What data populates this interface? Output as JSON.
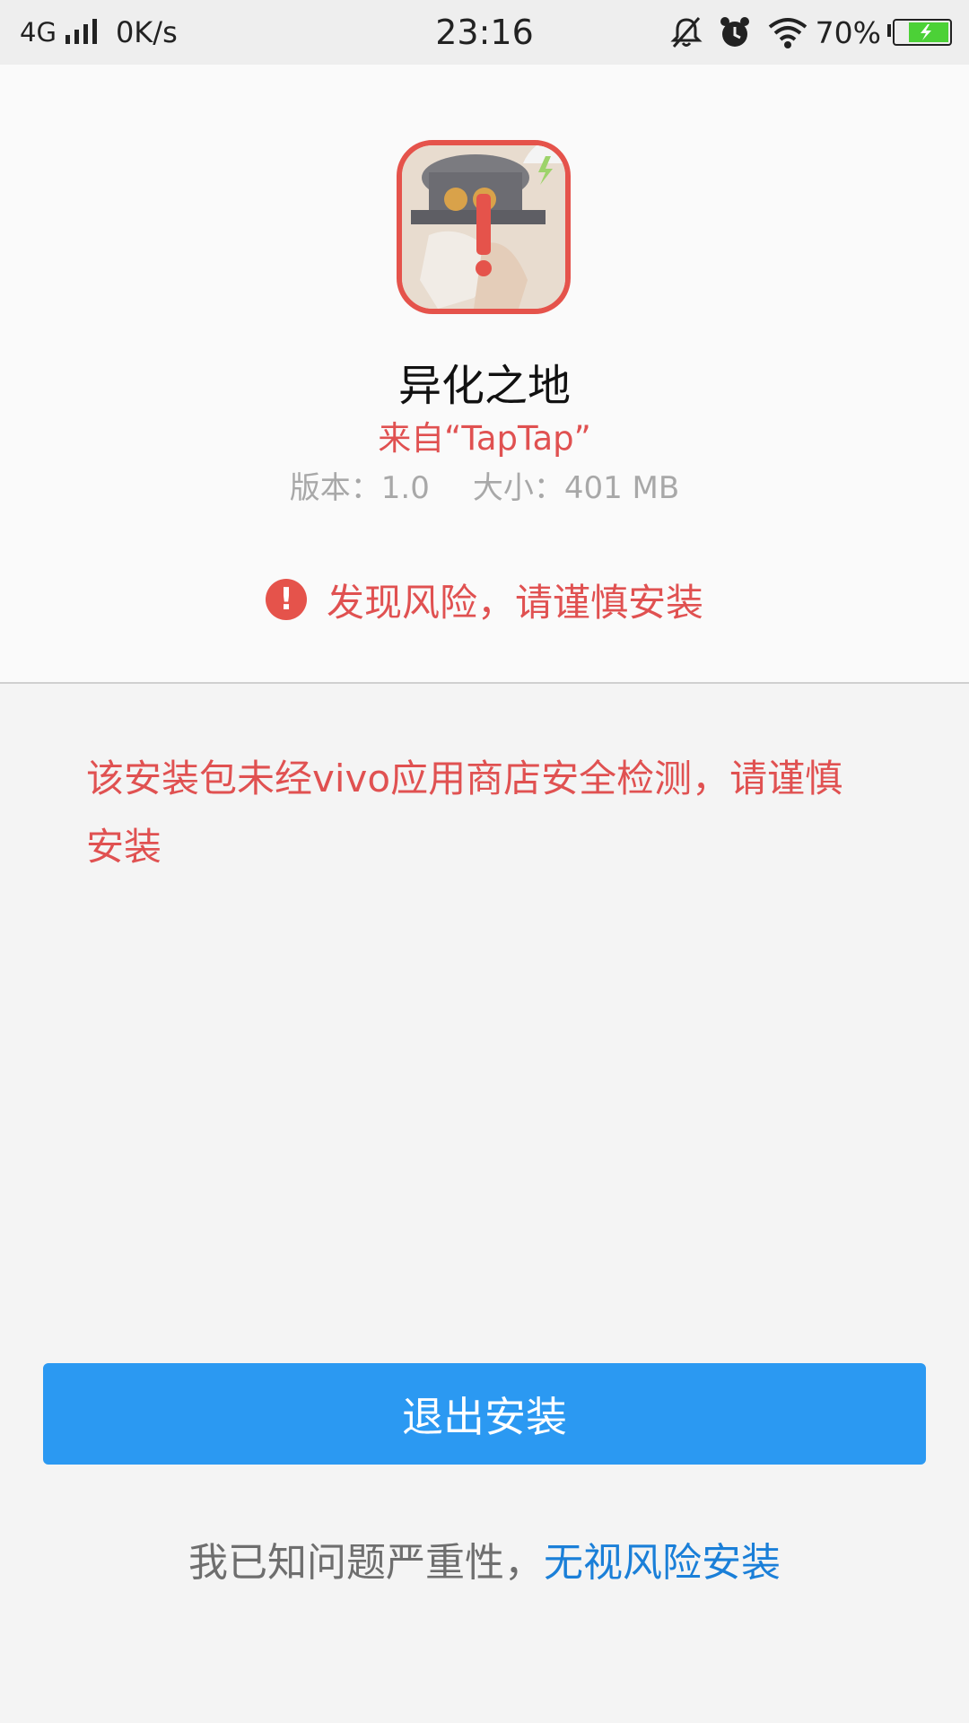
{
  "status_bar": {
    "network": "4G",
    "speed": "0K/s",
    "time": "23:16",
    "battery": "70%",
    "icons": [
      "signal-icon",
      "mute-icon",
      "alarm-icon",
      "wifi-icon",
      "battery-icon"
    ]
  },
  "app": {
    "name": "异化之地",
    "source": "来自“TapTap”",
    "version": "版本：1.0",
    "size": "大小：401 MB",
    "risk_title": "发现风险，请谨慎安装",
    "risk_icon_glyph": "!"
  },
  "warning": {
    "message": "该安装包未经vivo应用商店安全检测，请谨慎安装"
  },
  "actions": {
    "exit_label": "退出安装",
    "ignore_prefix": "我已知问题严重性，",
    "ignore_link": "无视风险安装"
  },
  "colors": {
    "accent_blue": "#2b99f2",
    "link_blue": "#1a7fd8",
    "risk_red": "#e05151"
  }
}
